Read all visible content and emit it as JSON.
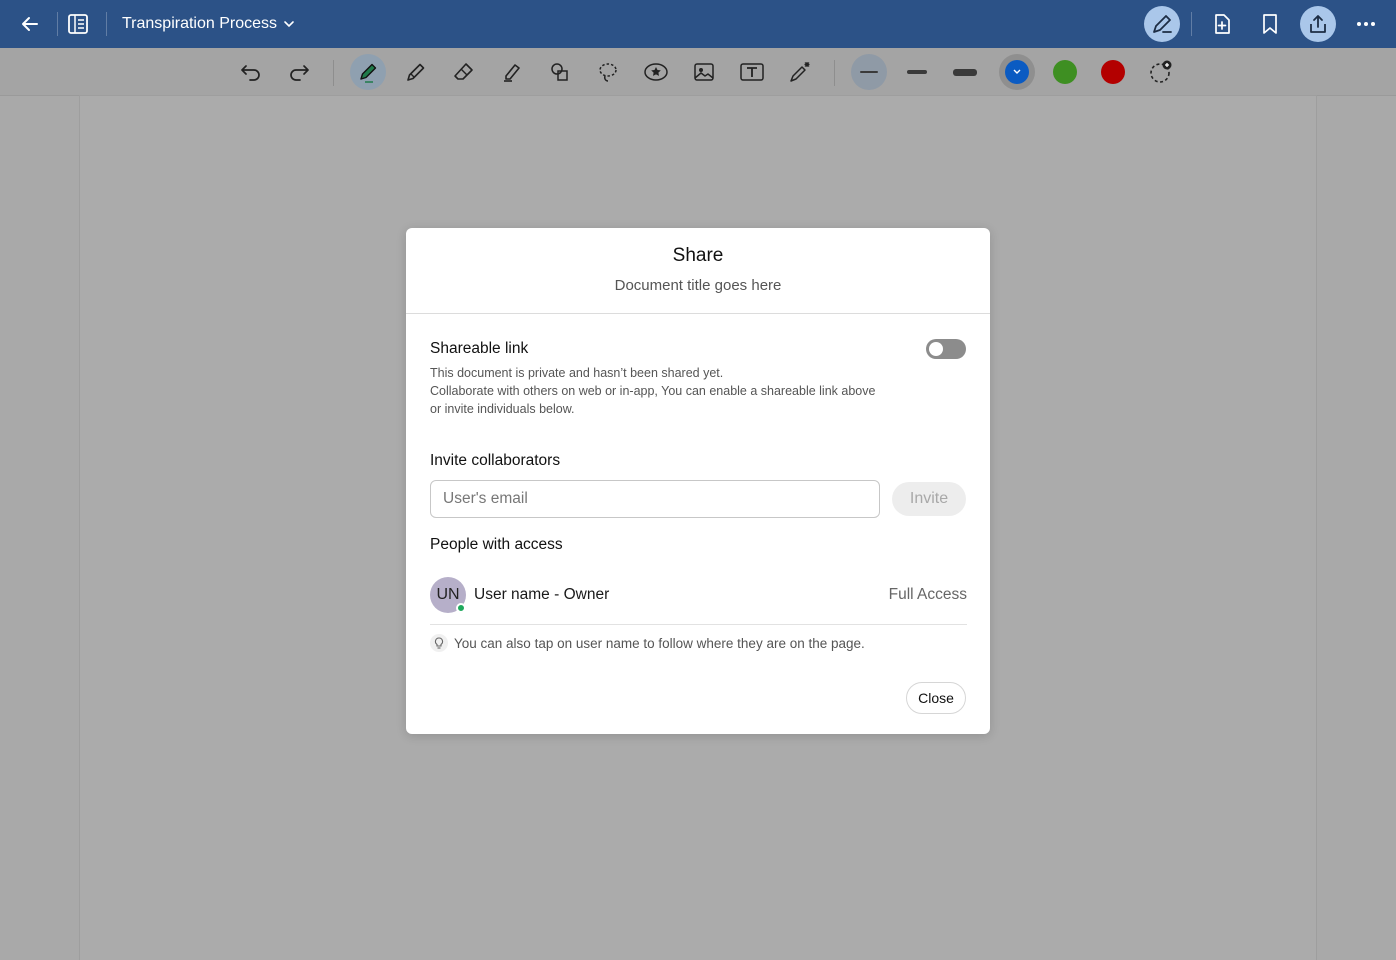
{
  "topbar": {
    "title": "Transpiration Process",
    "icons": [
      "back-arrow-icon",
      "sidebar-panel-icon",
      "chevron-down-icon",
      "pen-edit-icon",
      "add-page-icon",
      "bookmark-icon",
      "share-icon",
      "more-icon"
    ],
    "colors": {
      "bar": "#2c5287"
    }
  },
  "toolbar": {
    "tools": [
      "undo",
      "redo",
      "pen",
      "pencil",
      "eraser",
      "highlighter",
      "shapes",
      "lasso",
      "sticker",
      "image",
      "text-box",
      "magic-pen"
    ],
    "active_tool": "pen",
    "stroke_widths": [
      "thin",
      "medium",
      "thick"
    ],
    "active_stroke": "thin",
    "colors": [
      {
        "name": "blue",
        "hex": "#0b5bc2",
        "selected": true
      },
      {
        "name": "green",
        "hex": "#3e8f22",
        "selected": false
      },
      {
        "name": "red",
        "hex": "#b30000",
        "selected": false
      }
    ]
  },
  "share_dialog": {
    "title": "Share",
    "subtitle": "Document title goes here",
    "shareable_link": {
      "label": "Shareable link",
      "enabled": false,
      "description_1": "This document is private and hasn’t been shared yet.",
      "description_2": "Collaborate with others on web or in-app, You can enable a shareable link above or invite individuals below."
    },
    "invite": {
      "label": "Invite collaborators",
      "placeholder": "User's email",
      "value": "",
      "button": "Invite"
    },
    "people": {
      "label": "People with access",
      "list": [
        {
          "initials": "UN",
          "name": "User name - Owner",
          "access": "Full Access",
          "online": true
        }
      ]
    },
    "tip": "You can also tap on user name to follow where they are on the page.",
    "close_label": "Close"
  }
}
